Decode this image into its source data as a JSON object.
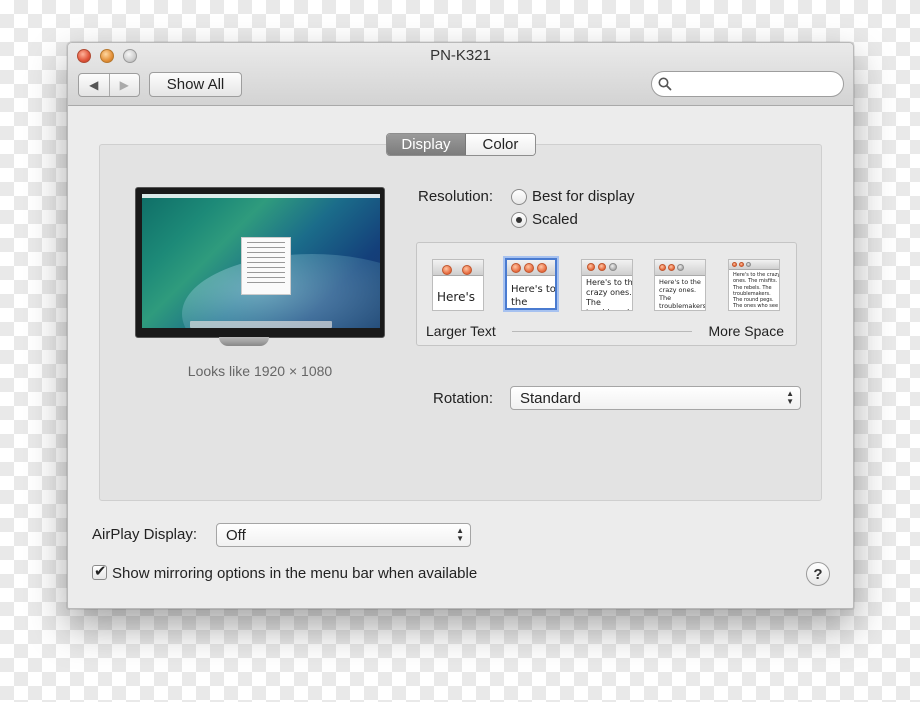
{
  "window": {
    "title": "PN-K321"
  },
  "toolbar": {
    "back_glyph": "◀",
    "forward_glyph": "▶",
    "show_all_label": "Show All",
    "search_placeholder": ""
  },
  "tabs": [
    {
      "label": "Display",
      "selected": true
    },
    {
      "label": "Color",
      "selected": false
    }
  ],
  "display": {
    "looks_like": "Looks like 1920 × 1080",
    "resolution_label": "Resolution:",
    "resolution_options": [
      {
        "label": "Best for display",
        "selected": false
      },
      {
        "label": "Scaled",
        "selected": true
      }
    ],
    "scale_options": [
      {
        "text": "Here's",
        "selected": false
      },
      {
        "text": "Here's to the troublemakers.",
        "selected": true
      },
      {
        "text": "Here's to the crazy ones. The troublemakers. The ones who see",
        "selected": false
      },
      {
        "text": "Here's to the crazy ones. The troublemakers. The ones who see things differently. They're not fond of rules. And they",
        "selected": false
      },
      {
        "text": "Here's to the crazy ones. The misfits. The rebels. The troublemakers. The round pegs. The ones who see things differently. They're not fond of rules. And they have no respect for the status quo. You can quote them, disagree with them. About the only thing",
        "selected": false
      }
    ],
    "scale_left_label": "Larger Text",
    "scale_right_label": "More Space",
    "rotation_label": "Rotation:",
    "rotation_value": "Standard"
  },
  "footer": {
    "airplay_label": "AirPlay Display:",
    "airplay_value": "Off",
    "mirroring_checkbox_label": "Show mirroring options in the menu bar when available",
    "mirroring_checked": true,
    "help_glyph": "?"
  }
}
